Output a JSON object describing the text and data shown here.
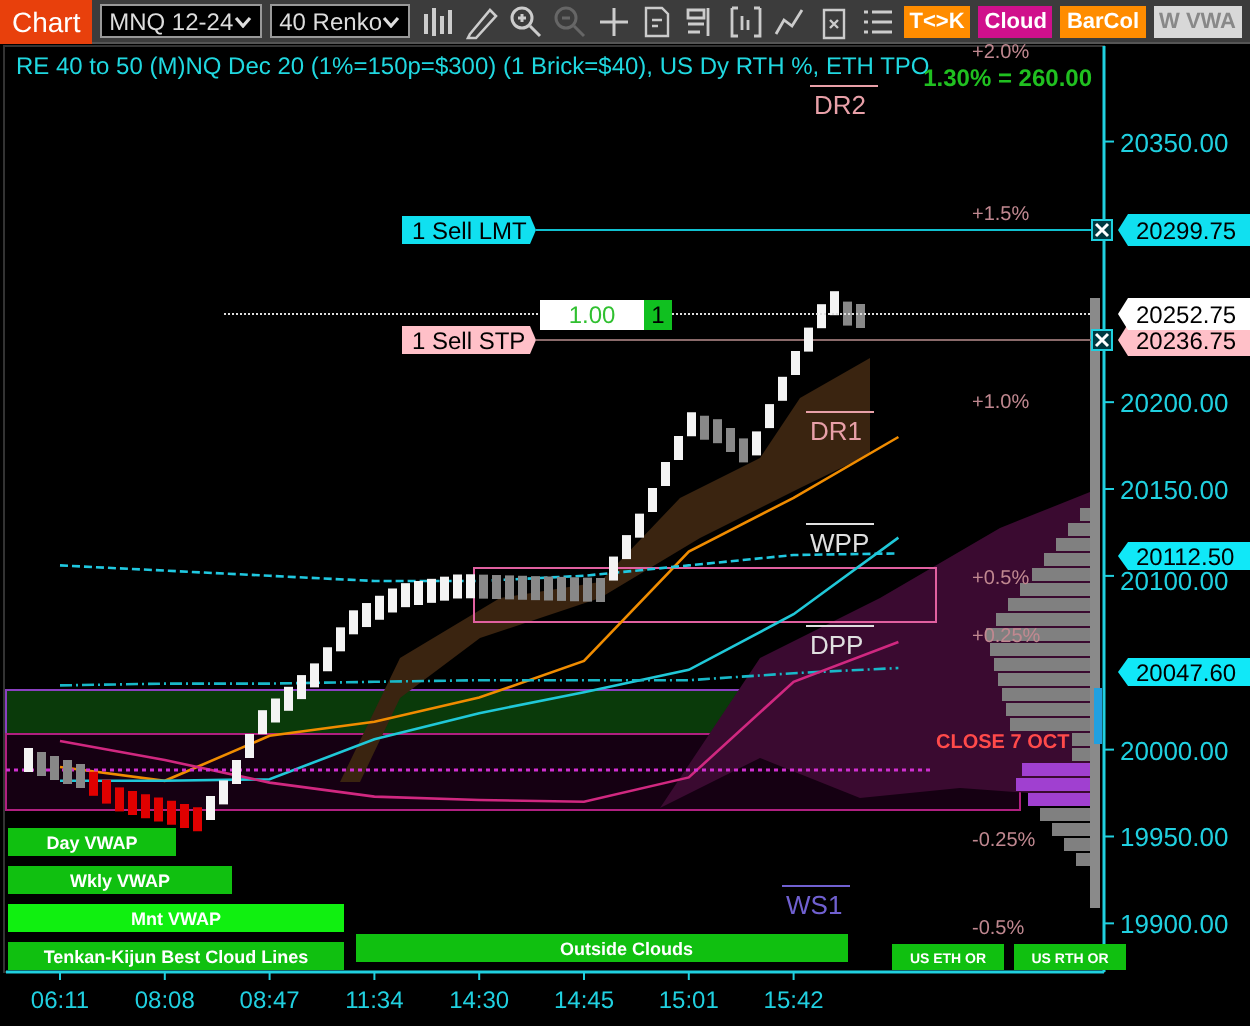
{
  "toolbar": {
    "tab": "Chart",
    "instrument": "MNQ 12-24",
    "bar_type": "40 Renko",
    "tools": [
      {
        "kind": "bars",
        "disabled": false
      },
      {
        "kind": "pencil",
        "disabled": false
      },
      {
        "kind": "zoom-in",
        "disabled": false
      },
      {
        "kind": "zoom-out",
        "disabled": true
      },
      {
        "kind": "crosshair",
        "disabled": false
      },
      {
        "kind": "document",
        "disabled": false
      },
      {
        "kind": "panel",
        "disabled": false
      },
      {
        "kind": "frame",
        "disabled": false
      },
      {
        "kind": "line",
        "disabled": false
      },
      {
        "kind": "clipboard",
        "disabled": false
      },
      {
        "kind": "list",
        "disabled": false
      }
    ],
    "buttons": [
      {
        "label": "T<>K",
        "color": "#ff8c00"
      },
      {
        "label": "Cloud",
        "color": "#d0108c"
      },
      {
        "label": "BarCol",
        "color": "#ff8c00"
      },
      {
        "label": "W VWA",
        "color": "#d8d8d8"
      }
    ]
  },
  "chart": {
    "title": "RE 40 to 50 (M)NQ Dec 20 (1%=150p=$300) (1 Brick=$40), US Dy RTH %, ETH TPO",
    "summary": "1.30% = 260.00",
    "percent_levels": [
      {
        "label": "+2.0%"
      },
      {
        "label": "+1.5%"
      },
      {
        "label": "+1.0%"
      },
      {
        "label": "+0.5%"
      },
      {
        "label": "+0.25%"
      },
      {
        "label": "-0.25%"
      },
      {
        "label": "-0.5%"
      }
    ],
    "pivots": [
      {
        "label": "DR2",
        "color": "#e8a0a8"
      },
      {
        "label": "DR1",
        "color": "#e8a0a8"
      },
      {
        "label": "WPP",
        "color": "#e0e0e0"
      },
      {
        "label": "DPP",
        "color": "#e0e0e0"
      },
      {
        "label": "WS1",
        "color": "#7060d0"
      }
    ],
    "orders": [
      {
        "kind": "limit",
        "label": "1 Sell LMT",
        "price": "20299.75"
      },
      {
        "kind": "stop",
        "label": "1 Sell STP",
        "price": "20236.75"
      }
    ],
    "position": {
      "quantity": "1.00",
      "count": "1",
      "price": "20252.75"
    },
    "close_label": "CLOSE 7 OCT",
    "chart_data": {
      "type": "line",
      "categories": [
        "06:11",
        "08:08",
        "08:47",
        "11:34",
        "14:30",
        "14:45",
        "15:01",
        "15:42",
        null
      ],
      "ylim": [
        19872,
        20405
      ],
      "series": [
        {
          "color": "#f08c00",
          "values": [
            19990,
            19982,
            20008,
            20016,
            20030,
            20051,
            20114,
            20145,
            20180
          ]
        },
        {
          "color": "#20c8d8",
          "values": [
            19982,
            19982,
            19983,
            20006,
            20021,
            20033,
            20046,
            20078,
            20122
          ]
        },
        {
          "color": "#20c8e0",
          "line_style": "dashed",
          "values": [
            20106,
            20103,
            20100,
            20097,
            20097,
            20100,
            20106,
            20112,
            20113
          ]
        },
        {
          "color": "#18b8c8",
          "line_style": "dashdot",
          "values": [
            20037,
            20038,
            20038,
            20039,
            20040,
            20040,
            20040,
            20044,
            20047
          ]
        },
        {
          "color": "#d02880",
          "values": [
            20005,
            19994,
            19981,
            19973,
            19971,
            19970,
            19984,
            20039,
            20062
          ]
        }
      ],
      "yticks": [
        {
          "value": 20350,
          "label": "20350.00"
        },
        {
          "value": 20200,
          "label": "20200.00"
        },
        {
          "value": 20150,
          "label": "20150.00"
        },
        {
          "value": 20100,
          "label": "20100.00"
        },
        {
          "value": 20000,
          "label": "20000.00"
        },
        {
          "value": 19950,
          "label": "19950.00"
        },
        {
          "value": 19900,
          "label": "19900.00"
        }
      ]
    },
    "price_markers": [
      "20112.50",
      "20047.60"
    ],
    "indicator_labels": [
      {
        "label": "Day VWAP"
      },
      {
        "label": "Wkly VWAP"
      },
      {
        "label": "Mnt VWAP"
      },
      {
        "label": "Tenkan-Kijun Best Cloud Lines"
      },
      {
        "label": "Outside Clouds"
      },
      {
        "label": "US ETH OR"
      },
      {
        "label": "US RTH OR"
      }
    ]
  }
}
